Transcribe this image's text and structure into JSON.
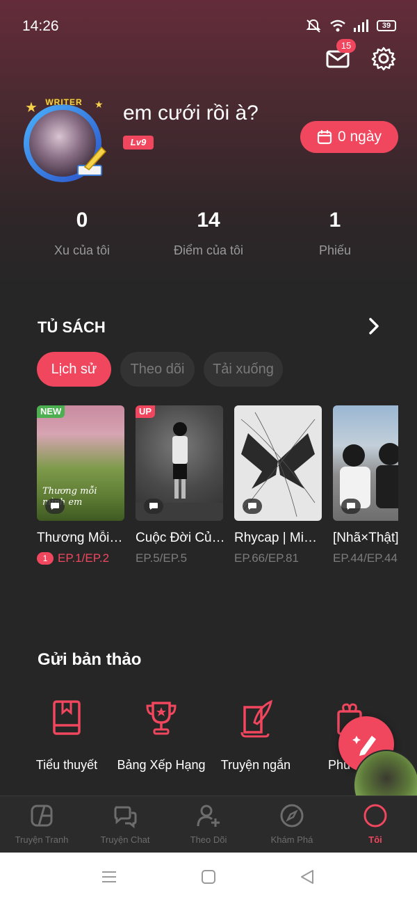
{
  "status_bar": {
    "time": "14:26",
    "battery": "39"
  },
  "header": {
    "mail_badge": "15"
  },
  "profile": {
    "writer_tag": "WRITER",
    "name": "em cưới rồi à?",
    "level": "Lv9",
    "checkin_label": "0 ngày"
  },
  "stats": [
    {
      "value": "0",
      "label": "Xu của tôi"
    },
    {
      "value": "14",
      "label": "Điểm của tôi"
    },
    {
      "value": "1",
      "label": "Phiếu"
    }
  ],
  "bookshelf": {
    "title": "TỦ SÁCH",
    "tabs": [
      "Lịch sử",
      "Theo dõi",
      "Tải xuống"
    ],
    "active_tab": "Lịch sử",
    "books": [
      {
        "tag": "NEW",
        "tag_color": "#4caf50",
        "title": "Thương Mỗi…",
        "ep": "EP.1/EP.2",
        "unread": "1",
        "cover_text": "Thương mỗi mình em"
      },
      {
        "tag": "UP",
        "tag_color": "#f0475f",
        "title": "Cuộc Đời Củ…",
        "ep": "EP.5/EP.5"
      },
      {
        "tag": "",
        "title": "Rhycap | Mi…",
        "ep": "EP.66/EP.81"
      },
      {
        "tag": "",
        "title": "[Nhã×Thật]",
        "ep": "EP.44/EP.44"
      }
    ]
  },
  "submit": {
    "title": "Gửi bản thảo",
    "items": [
      {
        "label": "Tiểu thuyết",
        "icon": "book-icon"
      },
      {
        "label": "Bảng Xếp Hạng",
        "icon": "trophy-icon"
      },
      {
        "label": "Truyện ngắn",
        "icon": "quill-icon"
      },
      {
        "label": "Phú",
        "icon": "gift-icon"
      }
    ]
  },
  "bottom_nav": [
    {
      "label": "Truyện Tranh",
      "icon": "comic-icon"
    },
    {
      "label": "Truyện Chat",
      "icon": "chat-icon"
    },
    {
      "label": "Theo Dõi",
      "icon": "follow-icon"
    },
    {
      "label": "Khám Phá",
      "icon": "compass-icon"
    },
    {
      "label": "Tôi",
      "icon": "me-icon",
      "active": true
    }
  ],
  "colors": {
    "accent": "#f0475f",
    "background": "#262626"
  }
}
